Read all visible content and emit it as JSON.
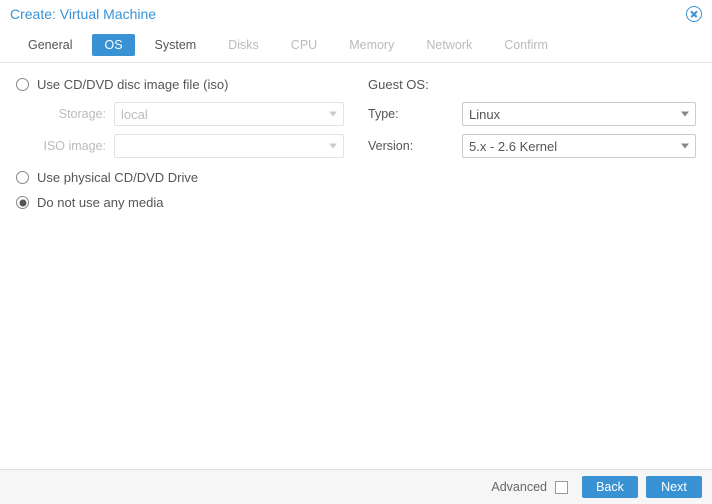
{
  "header": {
    "title": "Create: Virtual Machine"
  },
  "tabs": {
    "general": "General",
    "os": "OS",
    "system": "System",
    "disks": "Disks",
    "cpu": "CPU",
    "memory": "Memory",
    "network": "Network",
    "confirm": "Confirm"
  },
  "media": {
    "iso_label": "Use CD/DVD disc image file (iso)",
    "storage_label": "Storage:",
    "storage_value": "local",
    "isoimage_label": "ISO image:",
    "isoimage_value": "",
    "physical_label": "Use physical CD/DVD Drive",
    "none_label": "Do not use any media"
  },
  "guest": {
    "section": "Guest OS:",
    "type_label": "Type:",
    "type_value": "Linux",
    "version_label": "Version:",
    "version_value": "5.x - 2.6 Kernel"
  },
  "footer": {
    "advanced": "Advanced",
    "back": "Back",
    "next": "Next"
  }
}
